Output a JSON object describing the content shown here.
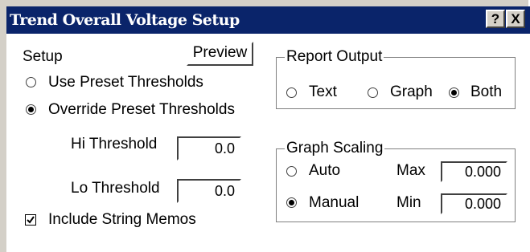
{
  "window": {
    "title": "Trend Overall Voltage Setup",
    "help_label": "?",
    "close_label": "X"
  },
  "setup": {
    "label": "Setup",
    "preview_label": "Preview",
    "use_preset_label": "Use Preset Thresholds",
    "override_label": "Override Preset Thresholds",
    "threshold_mode": "override",
    "hi_label": "Hi Threshold",
    "hi_value": "0.0",
    "lo_label": "Lo Threshold",
    "lo_value": "0.0",
    "include_memos_label": "Include String Memos",
    "include_memos_checked": true
  },
  "report_output": {
    "title": "Report Output",
    "text_label": "Text",
    "graph_label": "Graph",
    "both_label": "Both",
    "selected": "both"
  },
  "graph_scaling": {
    "title": "Graph Scaling",
    "auto_label": "Auto",
    "manual_label": "Manual",
    "selected": "manual",
    "max_label": "Max",
    "max_value": "0.000",
    "min_label": "Min",
    "min_value": "0.000"
  }
}
